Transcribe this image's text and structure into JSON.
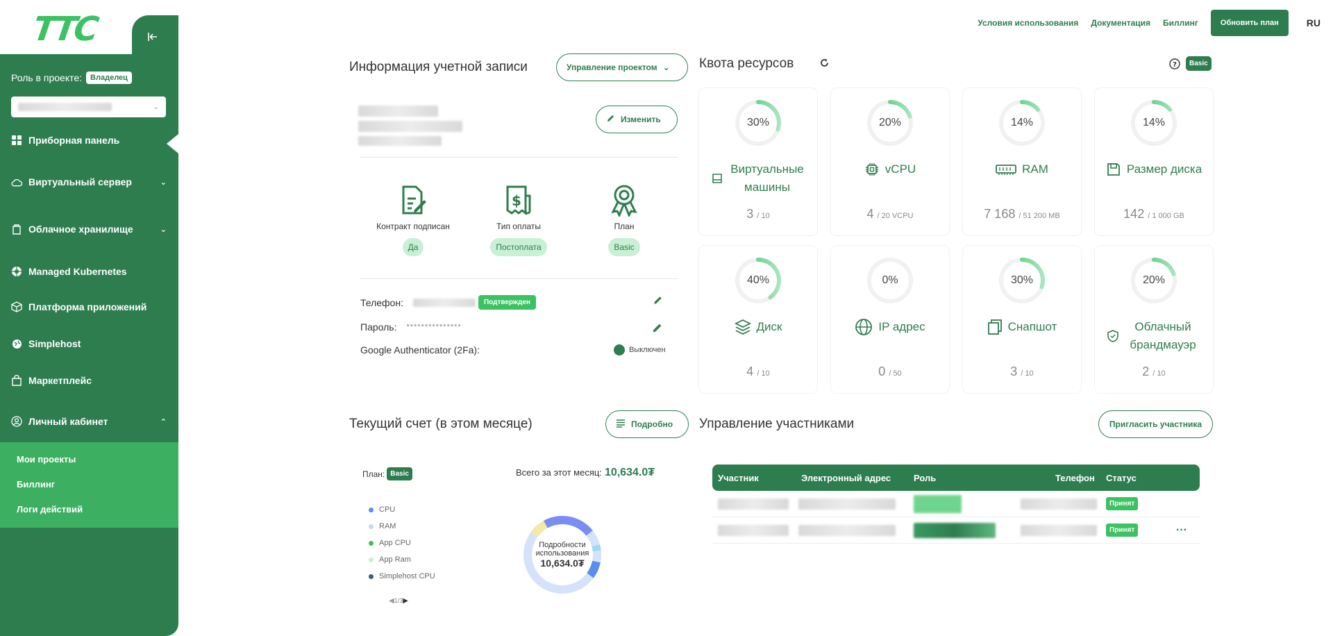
{
  "brand": {
    "logo_text": "TTC",
    "accent": "#2e7d4f",
    "bright": "#3cc163"
  },
  "sidebar": {
    "role_label": "Роль в проекте:",
    "role_value": "Владелец",
    "items": [
      {
        "label": "Приборная панель",
        "icon": "dashboard-icon"
      },
      {
        "label": "Виртуальный сервер",
        "icon": "cloud-icon"
      },
      {
        "label": "Облачное хранилище",
        "icon": "storage-icon"
      },
      {
        "label": "Managed Kubernetes",
        "icon": "kubernetes-icon"
      },
      {
        "label": "Платформа приложений",
        "icon": "box-icon"
      },
      {
        "label": "Simplehost",
        "icon": "globe-icon"
      },
      {
        "label": "Маркетплейс",
        "icon": "bag-icon"
      },
      {
        "label": "Личный кабинет",
        "icon": "user-icon"
      }
    ],
    "submenu": [
      "Мои проекты",
      "Биллинг",
      "Логи действий"
    ]
  },
  "topnav": {
    "links": [
      "Условия использования",
      "Документация",
      "Биллинг"
    ],
    "upgrade": "Обновить план",
    "lang": "RU"
  },
  "account": {
    "title": "Информация учетной записи",
    "manage_btn": "Управление проектом",
    "edit_btn": "Изменить",
    "cols": [
      {
        "label": "Контракт подписан",
        "value": "Да",
        "icon": "contract-icon"
      },
      {
        "label": "Тип оплаты",
        "value": "Постоплата",
        "icon": "payment-icon"
      },
      {
        "label": "План",
        "value": "Basic",
        "icon": "award-icon"
      }
    ],
    "phone_label": "Телефон:",
    "phone_badge": "Подтвержден",
    "password_label": "Пароль:",
    "password_value": "***************",
    "twofa_label": "Google Authenticator (2Fa):",
    "twofa_state": "Выключен"
  },
  "quota": {
    "title": "Квота ресурсов",
    "plan_badge": "Basic",
    "items": [
      {
        "name": "Виртуальные машины",
        "pct": 30,
        "used": "3",
        "total": "/ 10",
        "icon": "vm-icon"
      },
      {
        "name": "vCPU",
        "pct": 20,
        "used": "4",
        "total": "/ 20 VCPU",
        "icon": "cpu-icon"
      },
      {
        "name": "RAM",
        "pct": 14,
        "used": "7 168",
        "total": "/ 51 200 MB",
        "icon": "ram-icon"
      },
      {
        "name": "Размер диска",
        "pct": 14,
        "used": "142",
        "total": "/ 1 000 GB",
        "icon": "disk-size-icon"
      },
      {
        "name": "Диск",
        "pct": 40,
        "used": "4",
        "total": "/ 10",
        "icon": "layers-icon"
      },
      {
        "name": "IP адрес",
        "pct": 0,
        "used": "0",
        "total": "/ 50",
        "icon": "globe-icon"
      },
      {
        "name": "Снапшот",
        "pct": 30,
        "used": "3",
        "total": "/ 10",
        "icon": "snapshot-icon"
      },
      {
        "name": "Облачный брандмауэр",
        "pct": 20,
        "used": "2",
        "total": "/ 10",
        "icon": "shield-icon"
      }
    ]
  },
  "bill": {
    "title": "Текущий счет (в этом месяце)",
    "details_btn": "Подробно",
    "plan_label": "План:",
    "plan_value": "Basic",
    "total_label": "Всего за этот месяц:",
    "total_value": "10,634.0₮",
    "legend": [
      {
        "name": "CPU",
        "color": "#5b8def"
      },
      {
        "name": "RAM",
        "color": "#c9d8f5"
      },
      {
        "name": "App CPU",
        "color": "#3cc163"
      },
      {
        "name": "App Ram",
        "color": "#c8f0d4"
      },
      {
        "name": "Simplehost CPU",
        "color": "#3d5a80"
      }
    ],
    "pager": "1/3",
    "donut_label": "Подробности использования",
    "donut_value": "10,634.0₮"
  },
  "members": {
    "title": "Управление участниками",
    "invite_btn": "Пригласить участника",
    "columns": [
      "Участник",
      "Электронный адрес",
      "Роль",
      "Телефон",
      "Статус"
    ],
    "rows": [
      {
        "status": "Принят"
      },
      {
        "status": "Принят",
        "more": "···"
      }
    ]
  }
}
